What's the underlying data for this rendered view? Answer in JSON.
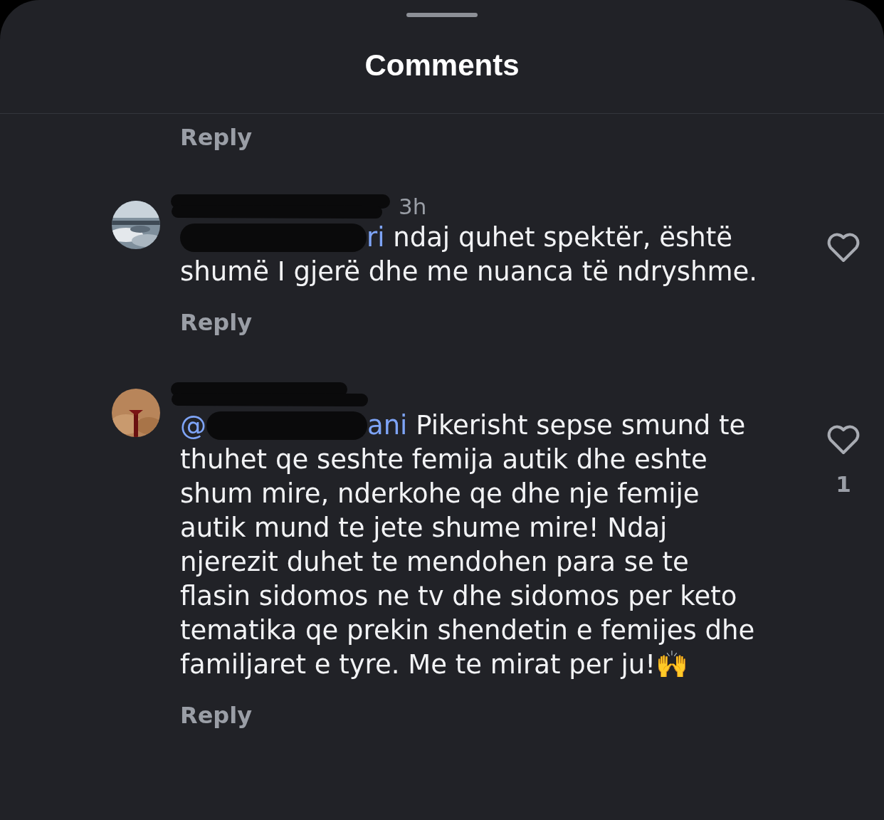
{
  "title": "Comments",
  "top_reply": "Reply",
  "comments": [
    {
      "time": "3h",
      "mention": [
        {
          "kind": "redacted"
        },
        {
          "kind": "text",
          "text": "ri"
        }
      ],
      "text": "ndaj quhet spektër, është shumë I gjerë dhe me nuanca të ndryshme.",
      "liked": false,
      "reply": "Reply"
    },
    {
      "mention": [
        {
          "kind": "text",
          "text": "@"
        },
        {
          "kind": "redacted"
        },
        {
          "kind": "text",
          "text": "ani"
        }
      ],
      "text": "Pikerisht sepse smund te thuhet qe seshte femija autik dhe eshte shum mire, nderkohe qe dhe nje femije autik mund te jete shume mire! Ndaj njerezit duhet te mendohen para se te flasin sidomos ne tv dhe sidomos per keto tematika qe prekin shendetin e femijes dhe familjaret e tyre. Me te mirat per ju!🙌",
      "liked": false,
      "likes": "1",
      "reply": "Reply"
    }
  ]
}
